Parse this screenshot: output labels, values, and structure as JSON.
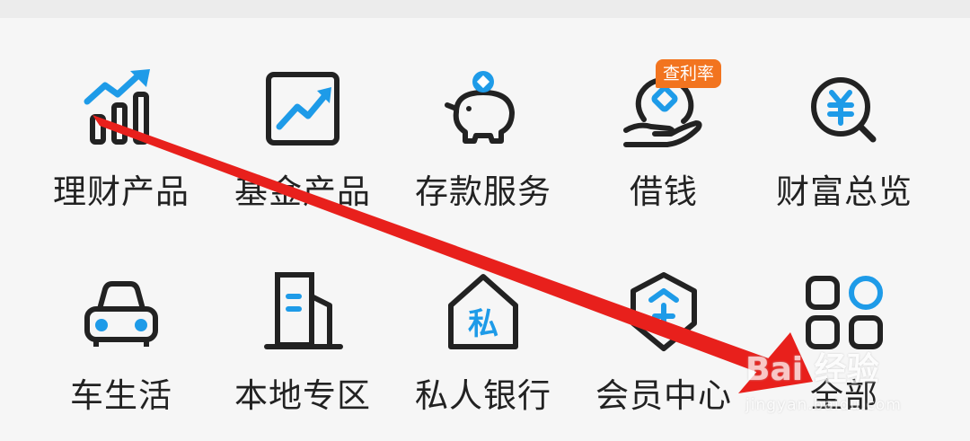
{
  "menu": {
    "row1": [
      {
        "label": "理财产品",
        "icon": "chart-bars-icon"
      },
      {
        "label": "基金产品",
        "icon": "fund-trend-icon"
      },
      {
        "label": "存款服务",
        "icon": "piggy-bank-icon"
      },
      {
        "label": "借钱",
        "icon": "loan-hand-icon"
      },
      {
        "label": "财富总览",
        "icon": "wealth-search-icon"
      }
    ],
    "row2": [
      {
        "label": "车生活",
        "icon": "car-icon"
      },
      {
        "label": "本地专区",
        "icon": "building-icon"
      },
      {
        "label": "私人银行",
        "icon": "private-bank-icon"
      },
      {
        "label": "会员中心",
        "icon": "member-shield-icon"
      },
      {
        "label": "全部",
        "icon": "all-grid-icon"
      }
    ]
  },
  "badge": {
    "text": "查利率"
  },
  "watermark": {
    "main": "Bai 经验",
    "sub": "jingyan.baidu.com"
  },
  "colors": {
    "accent": "#1e9be8",
    "dark": "#222222",
    "badge": "#f2741f",
    "arrow": "#e8201c"
  }
}
